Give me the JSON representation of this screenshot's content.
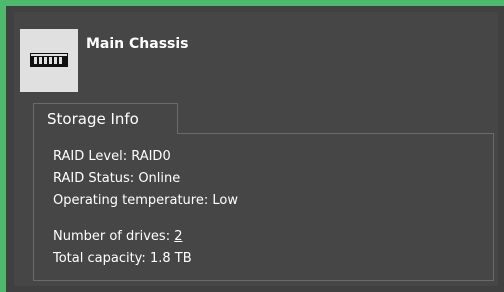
{
  "header": {
    "title": "Main Chassis",
    "icon": "chassis-icon"
  },
  "storage": {
    "tab_label": "Storage Info",
    "raid_level_label": "RAID Level: ",
    "raid_level_value": "RAID0",
    "raid_status_label": "RAID Status: ",
    "raid_status_value": "Online",
    "temperature_label": "Operating temperature: ",
    "temperature_value": "Low",
    "drives_label": "Number of drives: ",
    "drives_value": "2",
    "capacity_label": "Total capacity: ",
    "capacity_value": "1.8 TB"
  },
  "colors": {
    "accent": "#4db96c",
    "panel": "#404040",
    "inner_panel": "#464646",
    "icon_background": "#e0e0e0"
  }
}
